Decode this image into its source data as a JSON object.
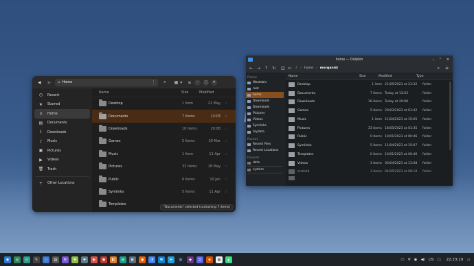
{
  "nautilus": {
    "title": "Home",
    "sidebar": [
      {
        "label": "Recent",
        "icon": "clock-icon"
      },
      {
        "label": "Starred",
        "icon": "star-icon"
      },
      {
        "label": "Home",
        "icon": "home-icon",
        "selected": true
      },
      {
        "label": "Documents",
        "icon": "document-icon"
      },
      {
        "label": "Downloads",
        "icon": "download-icon"
      },
      {
        "label": "Music",
        "icon": "music-icon"
      },
      {
        "label": "Pictures",
        "icon": "picture-icon"
      },
      {
        "label": "Videos",
        "icon": "video-icon"
      },
      {
        "label": "Trash",
        "icon": "trash-icon"
      },
      {
        "label": "Other Locations",
        "icon": "plus-icon"
      }
    ],
    "columns": {
      "name": "Name",
      "size": "Size",
      "modified": "Modified"
    },
    "rows": [
      {
        "name": "Desktop",
        "size": "1 item",
        "modified": "21 May"
      },
      {
        "name": "Documents",
        "size": "7 items",
        "modified": "13:03",
        "selected": true
      },
      {
        "name": "Downloads",
        "size": "18 items",
        "modified": "20:08"
      },
      {
        "name": "Games",
        "size": "5 items",
        "modified": "29 Mar"
      },
      {
        "name": "Music",
        "size": "1 item",
        "modified": "11 Apr"
      },
      {
        "name": "Pictures",
        "size": "33 items",
        "modified": "18 May"
      },
      {
        "name": "Public",
        "size": "0 items",
        "modified": "10 Jan"
      },
      {
        "name": "Symlinks",
        "size": "5 items",
        "modified": "11 Apr"
      },
      {
        "name": "Templates",
        "size": "",
        "modified": ""
      }
    ],
    "status": "\"Documents\" selected  (containing 7 items)"
  },
  "dolphin": {
    "title": "home — Dolphin",
    "breadcrumb": [
      "/",
      "home",
      "morganist"
    ],
    "places_label": "Places",
    "places": [
      {
        "label": "Wastebin"
      },
      {
        "label": "root"
      },
      {
        "label": "home",
        "selected": true
      },
      {
        "label": "Downloads"
      },
      {
        "label": "Downloads"
      },
      {
        "label": "Pictures"
      },
      {
        "label": "Videos"
      },
      {
        "label": "Symlinks"
      },
      {
        "label": "mydata"
      }
    ],
    "recent_label": "Recent",
    "recent": [
      {
        "label": "Recent Files"
      },
      {
        "label": "Recent Locations"
      }
    ],
    "devices_label": "Devices",
    "devices": [
      {
        "label": "data"
      },
      {
        "label": "system"
      }
    ],
    "columns": {
      "name": "Name",
      "size": "Size",
      "modified": "Modified",
      "type": "Type"
    },
    "rows": [
      {
        "name": "Desktop",
        "size": "1 item",
        "modified": "21/05/2023 at 23:32",
        "type": "folder"
      },
      {
        "name": "Documents",
        "size": "7 items",
        "modified": "Today at 13:03",
        "type": "folder"
      },
      {
        "name": "Downloads",
        "size": "18 items",
        "modified": "Today at 20:08",
        "type": "folder"
      },
      {
        "name": "Games",
        "size": "5 items",
        "modified": "29/03/2023 at 01:42",
        "type": "folder"
      },
      {
        "name": "Music",
        "size": "1 item",
        "modified": "11/04/2023 at 15:05",
        "type": "folder"
      },
      {
        "name": "Pictures",
        "size": "33 items",
        "modified": "18/05/2023 at 01:35",
        "type": "folder"
      },
      {
        "name": "Public",
        "size": "0 items",
        "modified": "10/01/2023 at 00:46",
        "type": "folder"
      },
      {
        "name": "Symlinks",
        "size": "5 items",
        "modified": "11/04/2023 at 15:07",
        "type": "folder"
      },
      {
        "name": "Templates",
        "size": "0 items",
        "modified": "10/01/2023 at 00:46",
        "type": "folder"
      },
      {
        "name": "Videos",
        "size": "3 items",
        "modified": "30/04/2023 at 13:08",
        "type": "folder"
      },
      {
        "name": "android",
        "size": "3 items",
        "modified": "04/05/2023 at 08:18",
        "type": "folder"
      },
      {
        "name": "",
        "size": "",
        "modified": "",
        "type": ""
      }
    ]
  },
  "taskbar": {
    "tray": {
      "keyboard": "US",
      "time": "22:23:19"
    },
    "apps": [
      "app-menu-icon",
      "terminal-icon",
      "settings-icon",
      "editor-icon",
      "folder-icon",
      "briefcase-icon",
      "gear-icon",
      "android-icon",
      "tool-icon",
      "video-icon",
      "pdf-icon",
      "image-icon",
      "network-icon",
      "camera-icon",
      "firefox-icon",
      "chrome-icon",
      "edge-icon",
      "telegram-icon",
      "steam-icon",
      "game-icon",
      "discord-icon",
      "game2-icon",
      "image-viewer-icon",
      "android-studio-icon"
    ]
  }
}
